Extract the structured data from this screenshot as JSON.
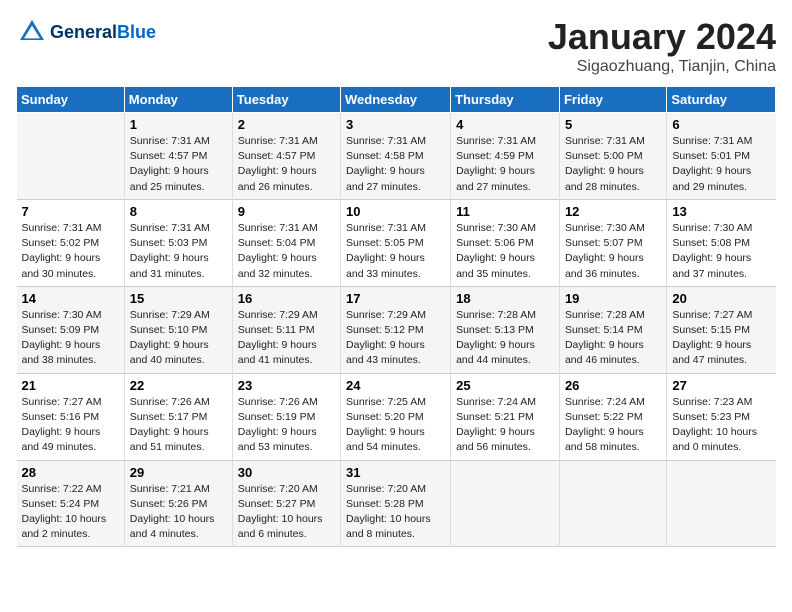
{
  "header": {
    "logo_general": "General",
    "logo_blue": "Blue",
    "month_title": "January 2024",
    "location": "Sigaozhuang, Tianjin, China"
  },
  "days_of_week": [
    "Sunday",
    "Monday",
    "Tuesday",
    "Wednesday",
    "Thursday",
    "Friday",
    "Saturday"
  ],
  "weeks": [
    [
      {
        "day": "",
        "info": ""
      },
      {
        "day": "1",
        "info": "Sunrise: 7:31 AM\nSunset: 4:57 PM\nDaylight: 9 hours\nand 25 minutes."
      },
      {
        "day": "2",
        "info": "Sunrise: 7:31 AM\nSunset: 4:57 PM\nDaylight: 9 hours\nand 26 minutes."
      },
      {
        "day": "3",
        "info": "Sunrise: 7:31 AM\nSunset: 4:58 PM\nDaylight: 9 hours\nand 27 minutes."
      },
      {
        "day": "4",
        "info": "Sunrise: 7:31 AM\nSunset: 4:59 PM\nDaylight: 9 hours\nand 27 minutes."
      },
      {
        "day": "5",
        "info": "Sunrise: 7:31 AM\nSunset: 5:00 PM\nDaylight: 9 hours\nand 28 minutes."
      },
      {
        "day": "6",
        "info": "Sunrise: 7:31 AM\nSunset: 5:01 PM\nDaylight: 9 hours\nand 29 minutes."
      }
    ],
    [
      {
        "day": "7",
        "info": "Sunrise: 7:31 AM\nSunset: 5:02 PM\nDaylight: 9 hours\nand 30 minutes."
      },
      {
        "day": "8",
        "info": "Sunrise: 7:31 AM\nSunset: 5:03 PM\nDaylight: 9 hours\nand 31 minutes."
      },
      {
        "day": "9",
        "info": "Sunrise: 7:31 AM\nSunset: 5:04 PM\nDaylight: 9 hours\nand 32 minutes."
      },
      {
        "day": "10",
        "info": "Sunrise: 7:31 AM\nSunset: 5:05 PM\nDaylight: 9 hours\nand 33 minutes."
      },
      {
        "day": "11",
        "info": "Sunrise: 7:30 AM\nSunset: 5:06 PM\nDaylight: 9 hours\nand 35 minutes."
      },
      {
        "day": "12",
        "info": "Sunrise: 7:30 AM\nSunset: 5:07 PM\nDaylight: 9 hours\nand 36 minutes."
      },
      {
        "day": "13",
        "info": "Sunrise: 7:30 AM\nSunset: 5:08 PM\nDaylight: 9 hours\nand 37 minutes."
      }
    ],
    [
      {
        "day": "14",
        "info": "Sunrise: 7:30 AM\nSunset: 5:09 PM\nDaylight: 9 hours\nand 38 minutes."
      },
      {
        "day": "15",
        "info": "Sunrise: 7:29 AM\nSunset: 5:10 PM\nDaylight: 9 hours\nand 40 minutes."
      },
      {
        "day": "16",
        "info": "Sunrise: 7:29 AM\nSunset: 5:11 PM\nDaylight: 9 hours\nand 41 minutes."
      },
      {
        "day": "17",
        "info": "Sunrise: 7:29 AM\nSunset: 5:12 PM\nDaylight: 9 hours\nand 43 minutes."
      },
      {
        "day": "18",
        "info": "Sunrise: 7:28 AM\nSunset: 5:13 PM\nDaylight: 9 hours\nand 44 minutes."
      },
      {
        "day": "19",
        "info": "Sunrise: 7:28 AM\nSunset: 5:14 PM\nDaylight: 9 hours\nand 46 minutes."
      },
      {
        "day": "20",
        "info": "Sunrise: 7:27 AM\nSunset: 5:15 PM\nDaylight: 9 hours\nand 47 minutes."
      }
    ],
    [
      {
        "day": "21",
        "info": "Sunrise: 7:27 AM\nSunset: 5:16 PM\nDaylight: 9 hours\nand 49 minutes."
      },
      {
        "day": "22",
        "info": "Sunrise: 7:26 AM\nSunset: 5:17 PM\nDaylight: 9 hours\nand 51 minutes."
      },
      {
        "day": "23",
        "info": "Sunrise: 7:26 AM\nSunset: 5:19 PM\nDaylight: 9 hours\nand 53 minutes."
      },
      {
        "day": "24",
        "info": "Sunrise: 7:25 AM\nSunset: 5:20 PM\nDaylight: 9 hours\nand 54 minutes."
      },
      {
        "day": "25",
        "info": "Sunrise: 7:24 AM\nSunset: 5:21 PM\nDaylight: 9 hours\nand 56 minutes."
      },
      {
        "day": "26",
        "info": "Sunrise: 7:24 AM\nSunset: 5:22 PM\nDaylight: 9 hours\nand 58 minutes."
      },
      {
        "day": "27",
        "info": "Sunrise: 7:23 AM\nSunset: 5:23 PM\nDaylight: 10 hours\nand 0 minutes."
      }
    ],
    [
      {
        "day": "28",
        "info": "Sunrise: 7:22 AM\nSunset: 5:24 PM\nDaylight: 10 hours\nand 2 minutes."
      },
      {
        "day": "29",
        "info": "Sunrise: 7:21 AM\nSunset: 5:26 PM\nDaylight: 10 hours\nand 4 minutes."
      },
      {
        "day": "30",
        "info": "Sunrise: 7:20 AM\nSunset: 5:27 PM\nDaylight: 10 hours\nand 6 minutes."
      },
      {
        "day": "31",
        "info": "Sunrise: 7:20 AM\nSunset: 5:28 PM\nDaylight: 10 hours\nand 8 minutes."
      },
      {
        "day": "",
        "info": ""
      },
      {
        "day": "",
        "info": ""
      },
      {
        "day": "",
        "info": ""
      }
    ]
  ]
}
